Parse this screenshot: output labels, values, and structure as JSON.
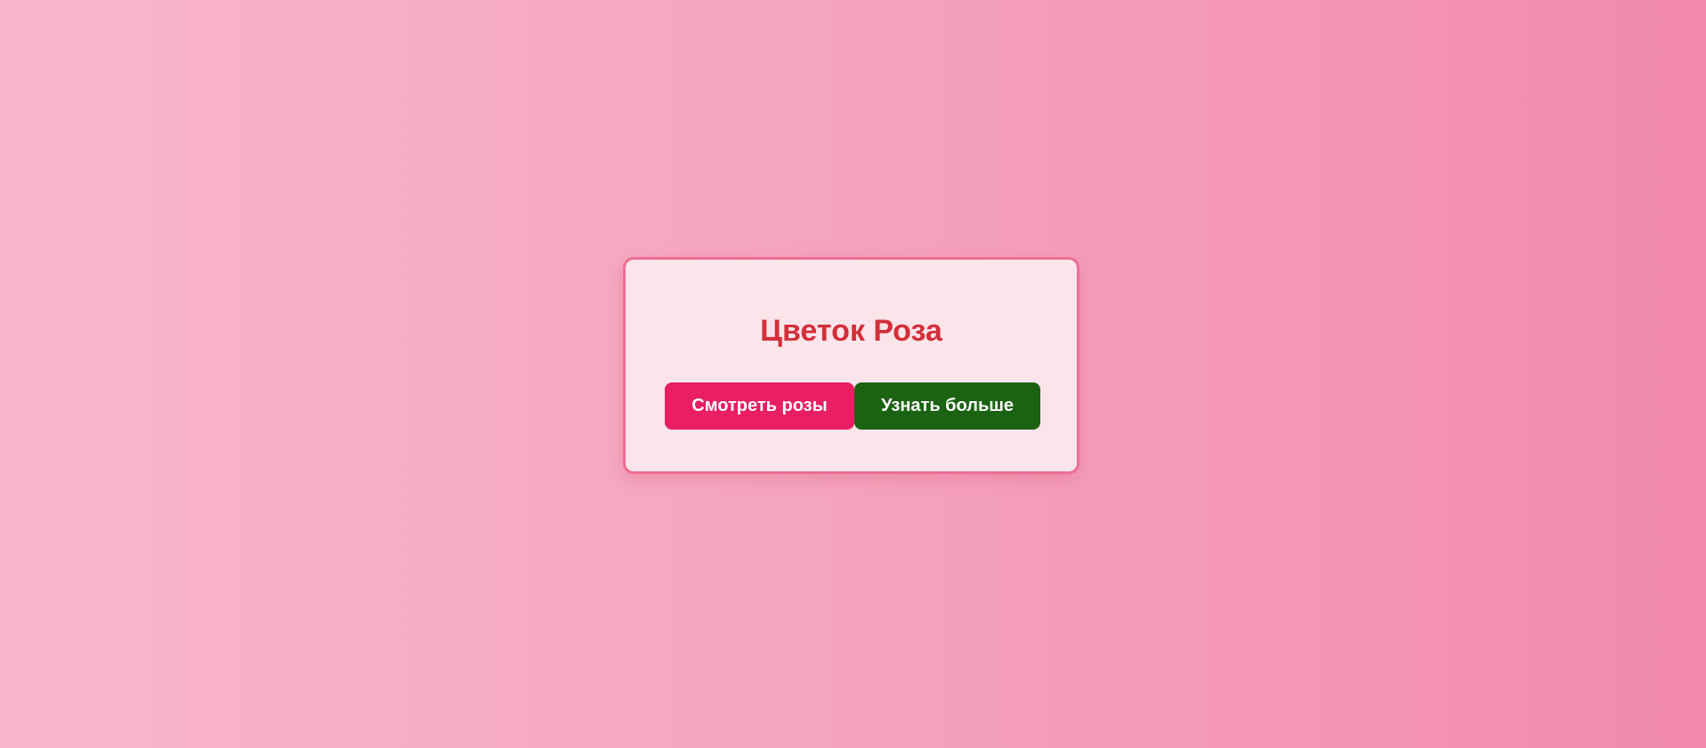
{
  "card": {
    "title": "Цветок Роза",
    "buttons": {
      "view_roses": "Смотреть розы",
      "learn_more": "Узнать больше"
    }
  },
  "colors": {
    "title": "#d32f3a",
    "primary_button": "#e91e63",
    "secondary_button": "#1b6312",
    "card_border": "#ee6d95",
    "card_background": "#fbe4ea"
  }
}
